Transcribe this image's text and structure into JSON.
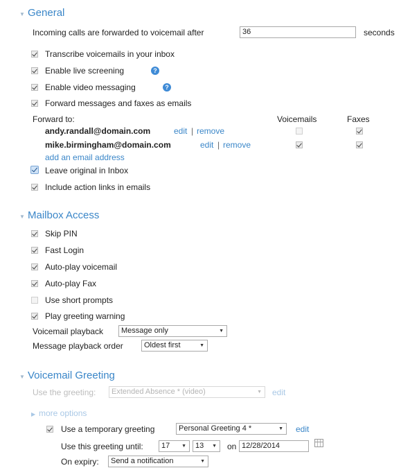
{
  "general": {
    "title": "General",
    "forward_after_label": "Incoming calls are forwarded to voicemail after",
    "forward_after_value": "36",
    "forward_after_unit": "seconds",
    "transcribe": {
      "label": "Transcribe voicemails in your inbox",
      "checked": true
    },
    "live_screening": {
      "label": "Enable live screening",
      "checked": true
    },
    "video_messaging": {
      "label": "Enable video messaging",
      "checked": true
    },
    "forward_emails": {
      "label": "Forward messages and faxes as emails",
      "checked": true
    },
    "forward_to_label": "Forward to:",
    "col_voicemails": "Voicemails",
    "col_faxes": "Faxes",
    "recipients": [
      {
        "email": "andy.randall@domain.com",
        "edit": "edit",
        "sep": "|",
        "remove": "remove",
        "voicemails": false,
        "faxes": true
      },
      {
        "email": "mike.birmingham@domain.com",
        "edit": "edit",
        "sep": "|",
        "remove": "remove",
        "voicemails": true,
        "faxes": true
      }
    ],
    "add_email": "add an email address",
    "leave_original": {
      "label": "Leave original in Inbox",
      "checked": true
    },
    "include_links": {
      "label": "Include action links in emails",
      "checked": true
    }
  },
  "mailbox": {
    "title": "Mailbox Access",
    "skip_pin": {
      "label": "Skip PIN",
      "checked": true
    },
    "fast_login": {
      "label": "Fast Login",
      "checked": true
    },
    "autoplay_voicemail": {
      "label": "Auto-play voicemail",
      "checked": true
    },
    "autoplay_fax": {
      "label": "Auto-play Fax",
      "checked": true
    },
    "short_prompts": {
      "label": "Use short prompts",
      "checked": false
    },
    "greeting_warning": {
      "label": "Play greeting warning",
      "checked": true
    },
    "vm_playback_label": "Voicemail playback",
    "vm_playback_value": "Message only",
    "msg_order_label": "Message playback order",
    "msg_order_value": "Oldest first"
  },
  "greeting": {
    "title": "Voicemail Greeting",
    "use_greeting_label": "Use the greeting:",
    "use_greeting_value": "Extended Absence * (video)",
    "edit": "edit",
    "more_options": "more options",
    "temp_greeting": {
      "label": "Use a temporary greeting",
      "checked": true
    },
    "temp_greeting_value": "Personal Greeting 4 *",
    "temp_edit": "edit",
    "until_label": "Use this greeting until:",
    "until_hour": "17",
    "until_minute": "13",
    "on_label": "on",
    "until_date": "12/28/2014",
    "expiry_label": "On expiry:",
    "expiry_value": "Send a notification"
  },
  "colors": {
    "accent": "#3a86c8",
    "help": "#3f8bd6"
  }
}
